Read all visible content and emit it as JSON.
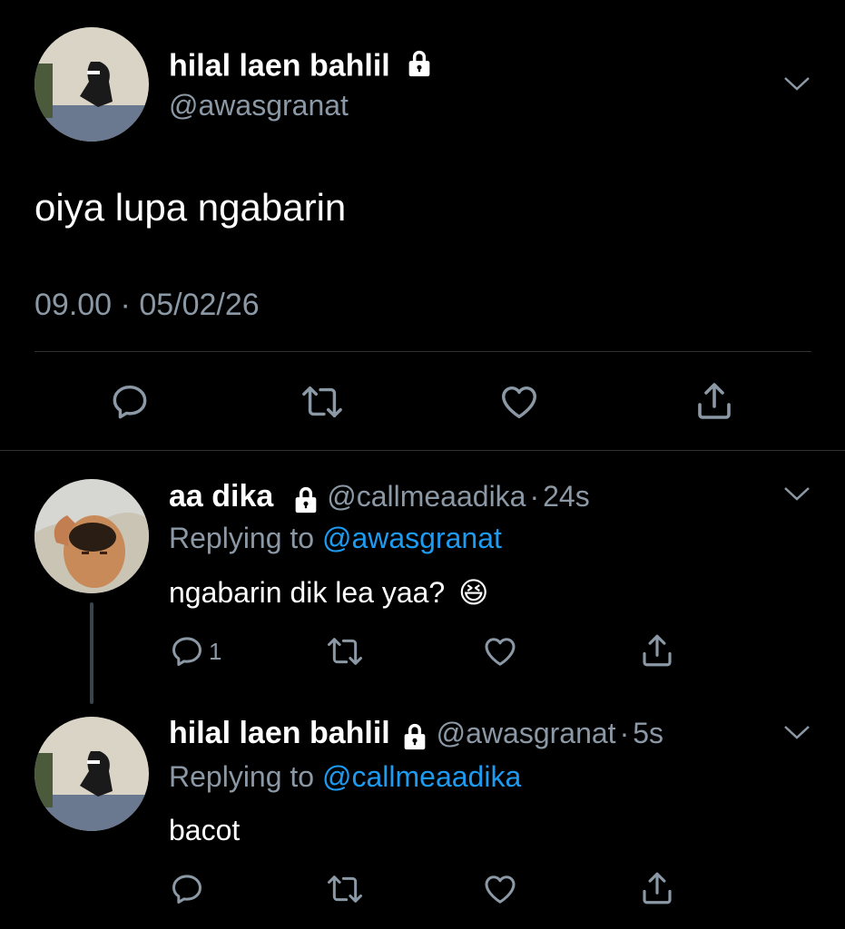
{
  "main_tweet": {
    "display_name": "hilal laen bahlil",
    "handle": "@awasgranat",
    "text": "oiya lupa ngabarin",
    "time": "09.00",
    "separator": "·",
    "date": "05/02/26"
  },
  "replies": [
    {
      "display_name": "aa dika",
      "handle": "@callmeaadika",
      "age": "24s",
      "separator": "·",
      "replying_prefix": "Replying to",
      "replying_handle": "@awasgranat",
      "text": "ngabarin dik lea yaa?",
      "emoji": "😆",
      "reply_count": "1"
    },
    {
      "display_name": "hilal laen bahlil",
      "handle": "@awasgranat",
      "age": "5s",
      "separator": "·",
      "replying_prefix": "Replying to",
      "replying_handle": "@callmeaadika",
      "text": "bacot"
    }
  ],
  "icons": {
    "reply": "reply-icon",
    "retweet": "retweet-icon",
    "like": "like-icon",
    "share": "share-icon",
    "lock": "lock-icon",
    "chevron": "chevron-down-icon"
  },
  "colors": {
    "background": "#000000",
    "text": "#ffffff",
    "secondary": "#8b98a5",
    "link": "#1d9bf0",
    "divider": "#2f3336"
  }
}
